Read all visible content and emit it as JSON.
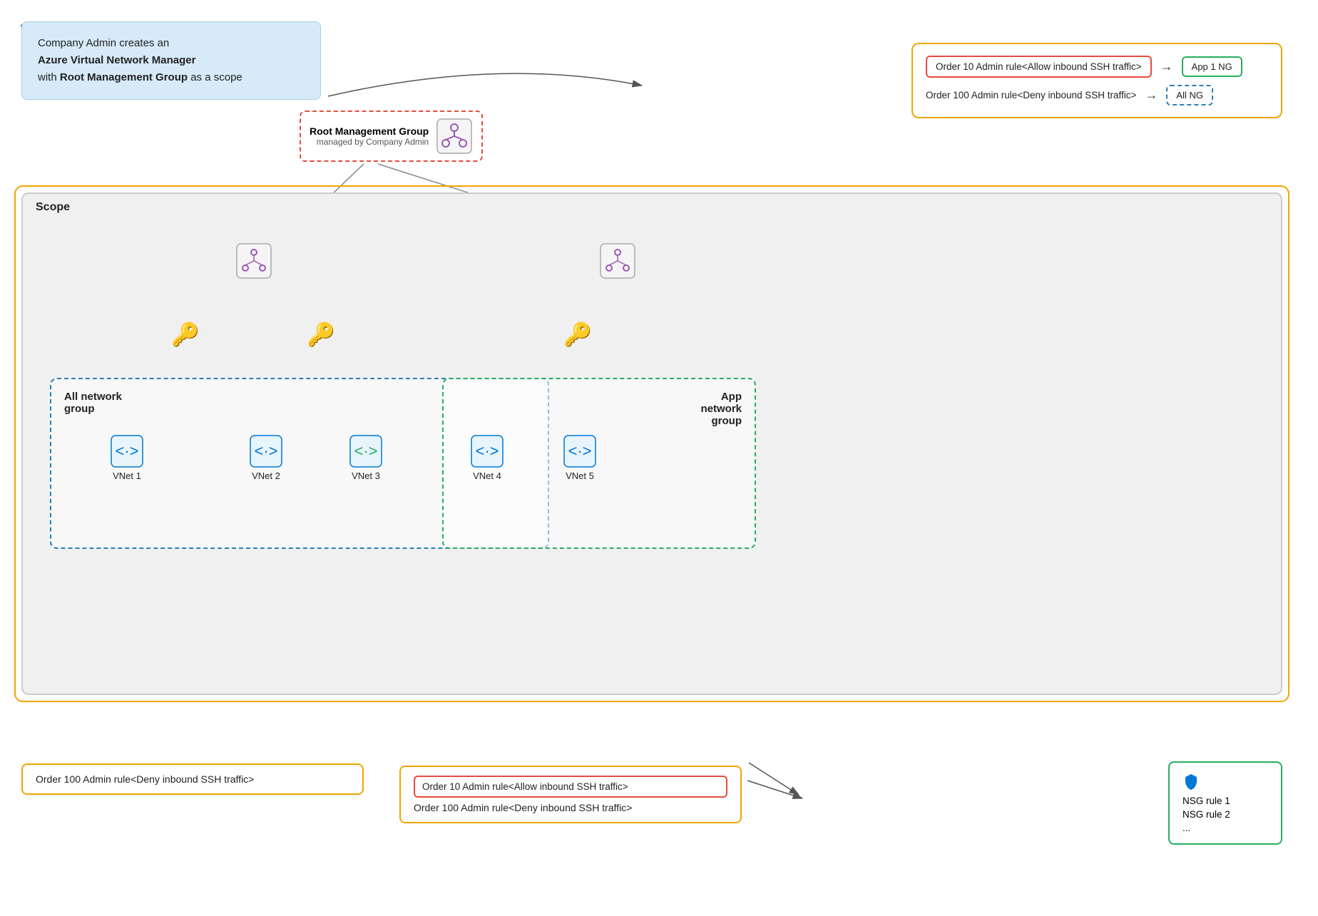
{
  "infoBox": {
    "line1": "Company Admin creates an",
    "line2bold": "Azure Virtual Network Manager",
    "line3": "with",
    "line3bold": "Root Management Group",
    "line3end": "as a scope"
  },
  "topRules": {
    "rule1": {
      "text": "Order 10 Admin rule<Allow inbound SSH traffic>",
      "arrow": "→",
      "badge": "App 1 NG",
      "badgeType": "green"
    },
    "rule2": {
      "text": "Order 100 Admin rule<Deny inbound SSH traffic>",
      "arrow": "→",
      "badge": "All NG",
      "badgeType": "blue"
    }
  },
  "rootMG": {
    "title": "Root Management Group",
    "subtitle": "managed by Company Admin"
  },
  "scope": {
    "label": "Scope"
  },
  "allNetworkGroup": {
    "label": "All network\ngroup"
  },
  "appNetworkGroup": {
    "label": "App\nnetwork\ngroup"
  },
  "vnets": [
    {
      "label": "VNet 1"
    },
    {
      "label": "VNet 2"
    },
    {
      "label": "VNet 3"
    },
    {
      "label": "VNet 4"
    },
    {
      "label": "VNet 5"
    }
  ],
  "bottomRuleLeft": {
    "text": "Order 100 Admin rule<Deny inbound SSH traffic>"
  },
  "bottomRuleRight": {
    "inner": "Order 10 Admin rule<Allow inbound SSH traffic>",
    "outer": "Order 100 Admin rule<Deny inbound SSH traffic>"
  },
  "nsgBox": {
    "line1": "NSG rule 1",
    "line2": "NSG rule 2",
    "line3": "..."
  },
  "colors": {
    "yellow": "#f0a500",
    "red": "#e74c3c",
    "green": "#27ae60",
    "blue": "#2980b9",
    "lightBlue": "#d6eaf8",
    "gray": "#f0f0f0"
  }
}
